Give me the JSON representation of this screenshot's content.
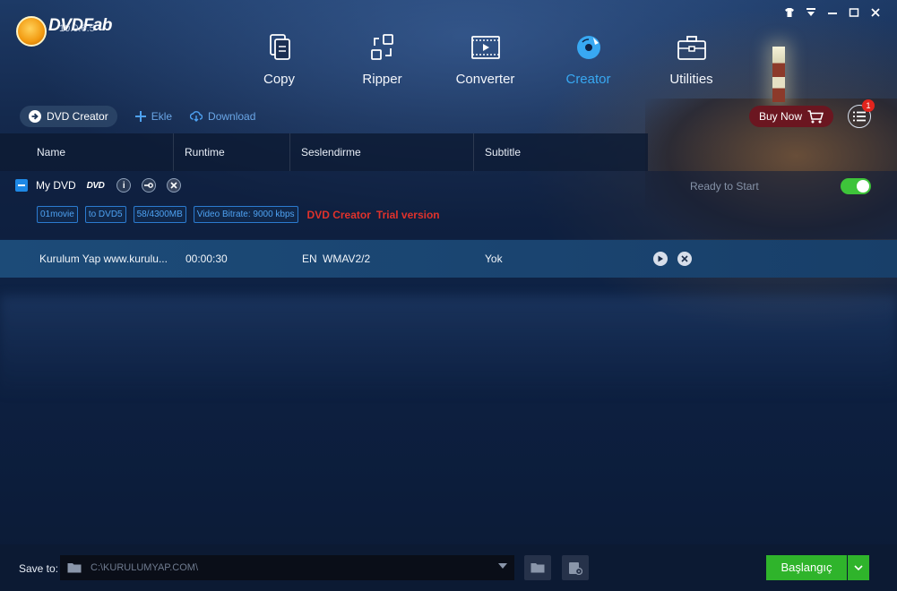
{
  "app": {
    "logo_text": "DVDFab",
    "version": "10.0.6.5"
  },
  "window_controls": [
    "shirt-icon",
    "dropdown-icon",
    "minimize-icon",
    "maximize-icon",
    "close-icon"
  ],
  "nav": {
    "items": [
      {
        "label": "Copy",
        "icon": "copy-icon",
        "active": false
      },
      {
        "label": "Ripper",
        "icon": "ripper-icon",
        "active": false
      },
      {
        "label": "Converter",
        "icon": "converter-icon",
        "active": false
      },
      {
        "label": "Creator",
        "icon": "creator-icon",
        "active": true
      },
      {
        "label": "Utilities",
        "icon": "utilities-icon",
        "active": false
      }
    ]
  },
  "toolbar": {
    "mode_label": "DVD Creator",
    "add_label": "Ekle",
    "download_label": "Download",
    "buy_label": "Buy Now",
    "task_badge": "1"
  },
  "table": {
    "headers": [
      "Name",
      "Runtime",
      "Seslendirme",
      "Subtitle"
    ]
  },
  "dvd": {
    "name": "My DVD",
    "dvd_logo": "DVD",
    "status": "Ready to Start",
    "enabled": true,
    "tags": [
      "01movie",
      "to DVD5",
      "58/4300MB",
      "Video Bitrate: 9000 kbps"
    ],
    "trial_product": "DVD Creator",
    "trial_text": "Trial version"
  },
  "track": {
    "name": "Kurulum Yap www.kurulu...",
    "runtime": "00:00:30",
    "audio_lang": "EN",
    "audio_codec": "WMAV2/2",
    "subtitle": "Yok"
  },
  "bottom": {
    "save_label": "Save to:",
    "path": "C:\\KURULUMYAP.COM\\",
    "start_label": "Başlangıç"
  },
  "colors": {
    "accent_blue": "#38a8f2",
    "start_green": "#2fb42b",
    "trial_red": "#e0322b",
    "buy_now_bg": "#6b1620"
  }
}
